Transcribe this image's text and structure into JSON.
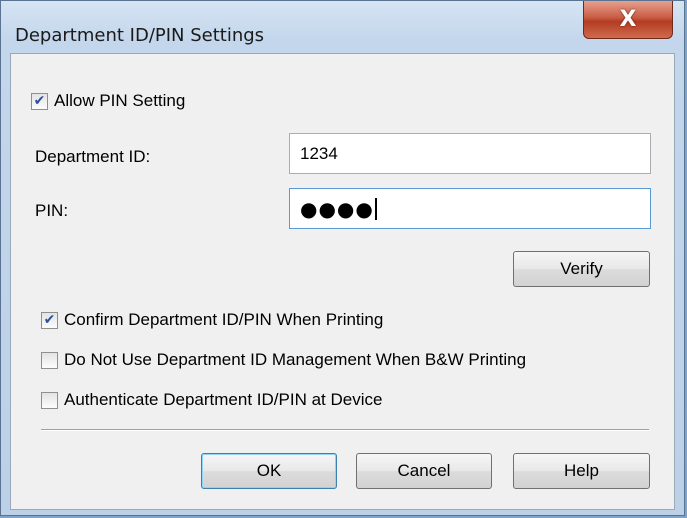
{
  "window": {
    "title": "Department ID/PIN Settings",
    "close_glyph": "X"
  },
  "allow_pin": {
    "label": "Allow PIN Setting",
    "checked": true
  },
  "department_id": {
    "label": "Department ID:",
    "value": "1234"
  },
  "pin": {
    "label": "PIN:",
    "masked_value": "●●●●"
  },
  "verify_button": "Verify",
  "options": [
    {
      "label": "Confirm Department ID/PIN When Printing",
      "checked": true
    },
    {
      "label": "Do Not Use Department ID Management When B&W Printing",
      "checked": false
    },
    {
      "label": "Authenticate Department ID/PIN at Device",
      "checked": false
    }
  ],
  "buttons": {
    "ok": "OK",
    "cancel": "Cancel",
    "help": "Help"
  }
}
